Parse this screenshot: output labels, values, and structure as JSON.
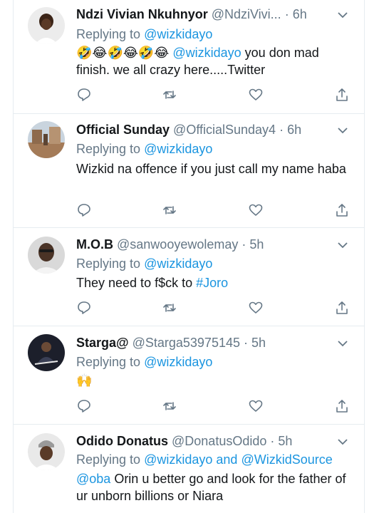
{
  "tweets": [
    {
      "name": "Ndzi Vivian Nkuhnyor",
      "handle": "@NdziVivi...",
      "time": "6h",
      "replying_label": "Replying to",
      "reply_to": "@wizkidayo",
      "emojis": "🤣😂🤣😂🤣😂",
      "body_mention": "@wizkidayo",
      "body_text": " you don mad finish.  we all crazy here.....Twitter"
    },
    {
      "name": "Official Sunday",
      "handle": "@OfficialSunday4",
      "time": "6h",
      "replying_label": "Replying to",
      "reply_to": "@wizkidayo",
      "body_text": "Wizkid na offence if you just call my name haba"
    },
    {
      "name": "M.O.B",
      "handle": "@sanwooyewolemay",
      "time": "5h",
      "replying_label": "Replying to",
      "reply_to": "@wizkidayo",
      "body_text": "They need to f$ck to ",
      "body_hashtag": "#Joro"
    },
    {
      "name": "Starga@",
      "handle": "@Starga53975145",
      "time": "5h",
      "replying_label": "Replying to",
      "reply_to": "@wizkidayo",
      "emojis": "🙌"
    },
    {
      "name": "Odido Donatus",
      "handle": "@DonatusOdido",
      "time": "5h",
      "replying_label": "Replying to",
      "reply_to": "@wizkidayo",
      "reply_and": "and",
      "reply_to_2": "@WizkidSource",
      "body_mention": "@oba",
      "body_text": " Orin u better go and look for the father of ur unborn billions or Niara"
    }
  ],
  "separator": "·",
  "icons": [
    "reply-icon",
    "retweet-icon",
    "like-icon",
    "share-icon",
    "chevron-down-icon"
  ],
  "colors": {
    "link": "#1b95e0",
    "muted": "#657786",
    "text": "#14171a",
    "border": "#e6ecf0"
  }
}
